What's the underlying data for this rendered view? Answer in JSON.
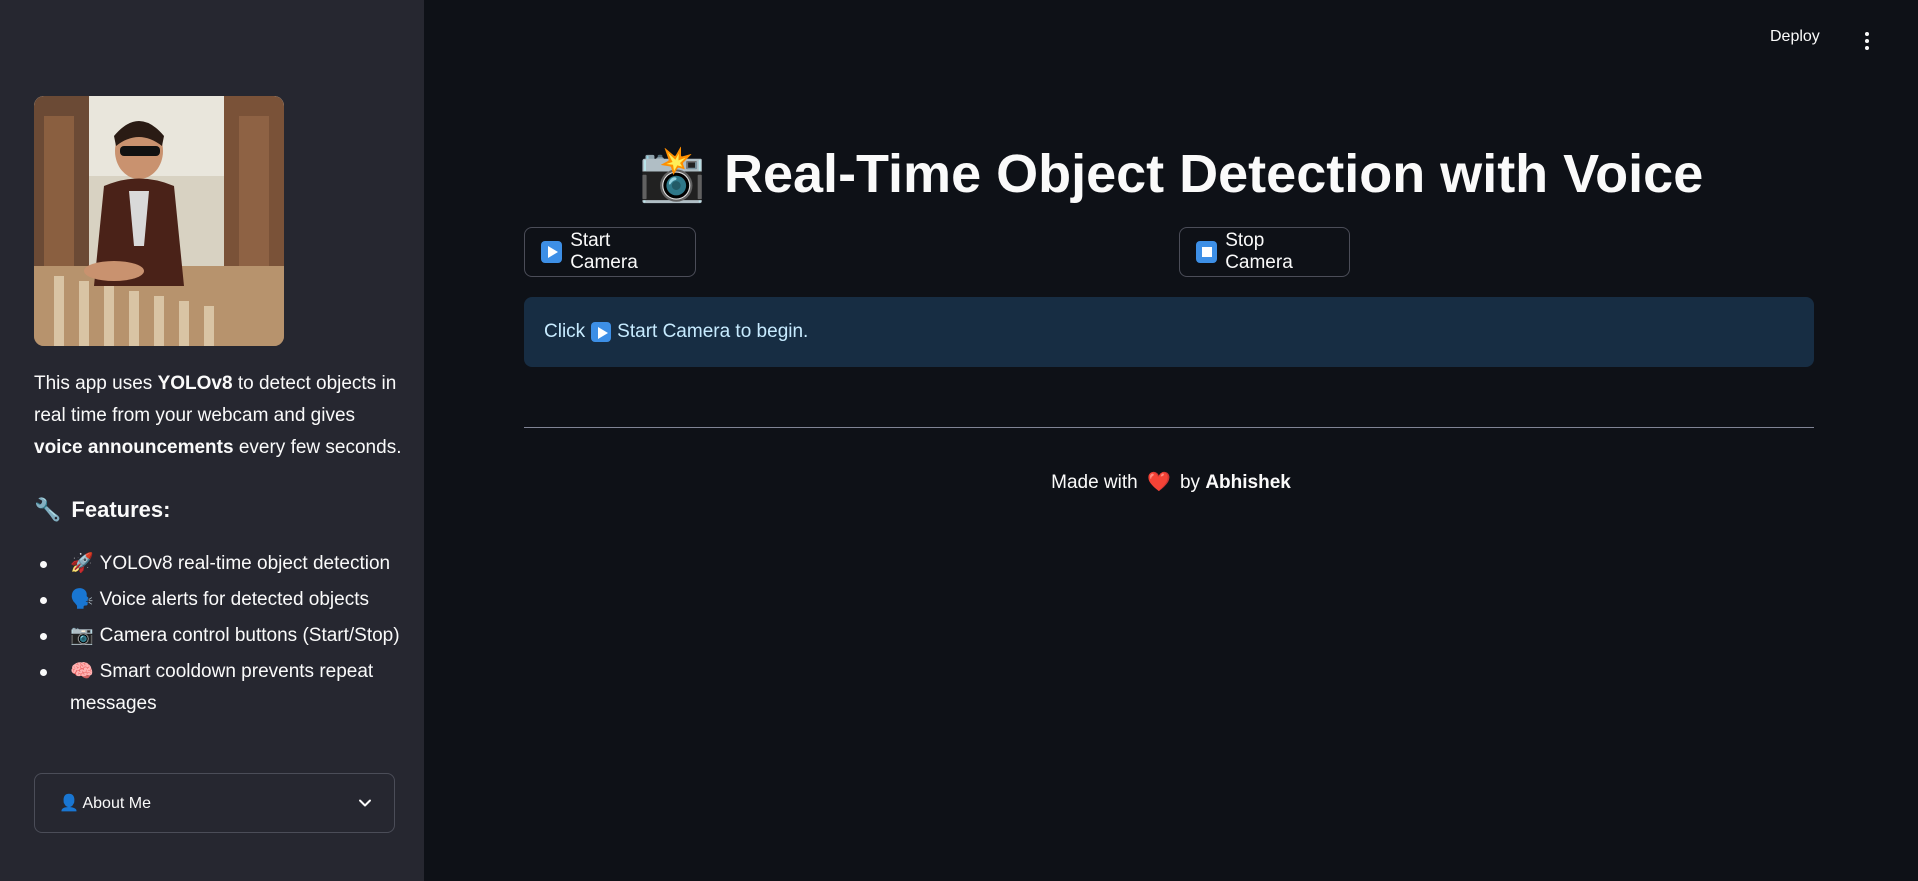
{
  "sidebar": {
    "intro": {
      "part1": "This app uses ",
      "bold1": "YOLOv8",
      "part2": " to detect objects in real time from your webcam and gives ",
      "bold2": "voice announcements",
      "part3": " every few seconds."
    },
    "features_icon": "🔧",
    "features_heading": "Features:",
    "features": [
      {
        "icon": "🚀",
        "text": "YOLOv8 real-time object detection"
      },
      {
        "icon": "🗣️",
        "text": "Voice alerts for detected objects"
      },
      {
        "icon": "📷",
        "text": "Camera control buttons (Start/Stop)"
      },
      {
        "icon": "🧠",
        "text": "Smart cooldown prevents repeat messages"
      }
    ],
    "expander_icon": "👤",
    "expander_label": "About Me"
  },
  "header": {
    "deploy_label": "Deploy"
  },
  "main": {
    "title_icon": "📸",
    "title": "Real-Time Object Detection with Voice",
    "start_button": "Start Camera",
    "stop_button": "Stop Camera",
    "info_prefix": "Click",
    "info_suffix": "Start Camera to begin.",
    "footer": {
      "made_with": "Made with",
      "heart": "❤️",
      "by": "by",
      "author": "Abhishek"
    }
  },
  "colors": {
    "background": "#0e1117",
    "sidebar": "#262730",
    "info_bg": "#172d43",
    "info_text": "#c7ebff",
    "accent_blue": "#3d8fe6"
  }
}
